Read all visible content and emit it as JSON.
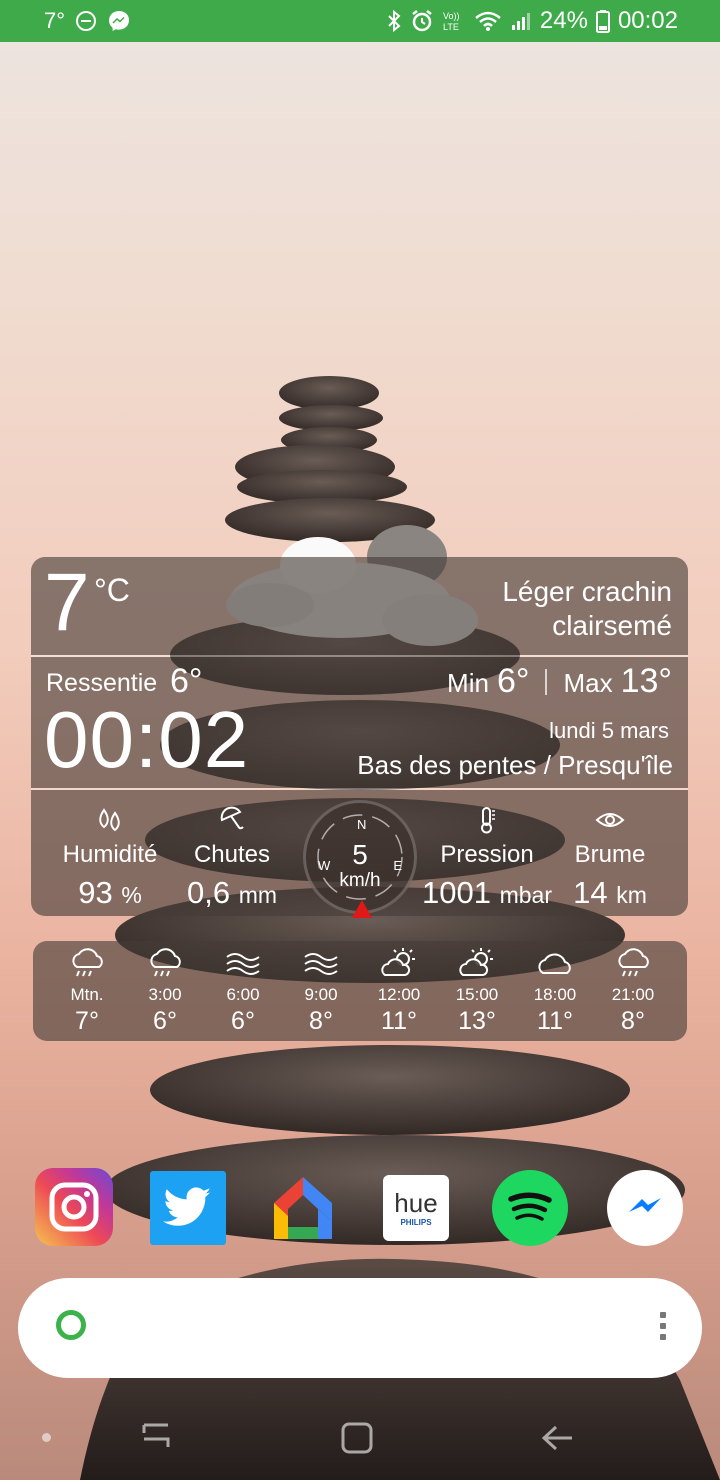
{
  "status_bar": {
    "temp": "7°",
    "battery": "24%",
    "time": "00:02",
    "icons": [
      "dnd-icon",
      "messenger-icon",
      "bluetooth-icon",
      "alarm-icon",
      "volte-icon",
      "wifi-icon",
      "signal-icon",
      "battery-icon"
    ]
  },
  "weather": {
    "temperature": "7",
    "temperature_unit": "°C",
    "condition": "Léger crachin clairsemé",
    "feels_label": "Ressentie",
    "feels_value": "6°",
    "min_label": "Min",
    "min_value": "6°",
    "max_label": "Max",
    "max_value": "13°",
    "time": "00:02",
    "date": "lundi 5 mars",
    "location": "Bas des pentes / Presqu'île",
    "humidity": {
      "label": "Humidité",
      "value": "93",
      "unit": "%"
    },
    "rain": {
      "label": "Chutes",
      "value": "0,6",
      "unit": "mm"
    },
    "wind": {
      "speed": "5",
      "unit": "km/h",
      "n": "N",
      "e": "E",
      "w": "W"
    },
    "pressure": {
      "label": "Pression",
      "value": "1001",
      "unit": "mbar"
    },
    "visibility": {
      "label": "Brume",
      "value": "14",
      "unit": "km"
    }
  },
  "hourly": [
    {
      "time": "Mtn.",
      "temp": "7°",
      "icon": "rain-cloud-icon"
    },
    {
      "time": "3:00",
      "temp": "6°",
      "icon": "rain-cloud-icon"
    },
    {
      "time": "6:00",
      "temp": "6°",
      "icon": "fog-icon"
    },
    {
      "time": "9:00",
      "temp": "8°",
      "icon": "fog-icon"
    },
    {
      "time": "12:00",
      "temp": "11°",
      "icon": "partly-sunny-icon"
    },
    {
      "time": "15:00",
      "temp": "13°",
      "icon": "partly-sunny-icon"
    },
    {
      "time": "18:00",
      "temp": "11°",
      "icon": "cloud-icon"
    },
    {
      "time": "21:00",
      "temp": "8°",
      "icon": "rain-cloud-icon"
    }
  ],
  "dock": {
    "apps": [
      {
        "name": "instagram-app",
        "icon": "instagram-icon"
      },
      {
        "name": "twitter-app",
        "icon": "twitter-icon"
      },
      {
        "name": "google-home-app",
        "icon": "google-home-icon"
      },
      {
        "name": "hue-app",
        "icon": "hue-icon",
        "text": "hue",
        "subtext": "PHILIPS"
      },
      {
        "name": "spotify-app",
        "icon": "spotify-icon"
      },
      {
        "name": "messenger-app",
        "icon": "messenger-icon"
      }
    ]
  },
  "search": {
    "placeholder": ""
  },
  "colors": {
    "status_bar": "#3faa4a",
    "accent_red": "#e01818",
    "spotify": "#1ed760",
    "twitter": "#1da1f2"
  }
}
